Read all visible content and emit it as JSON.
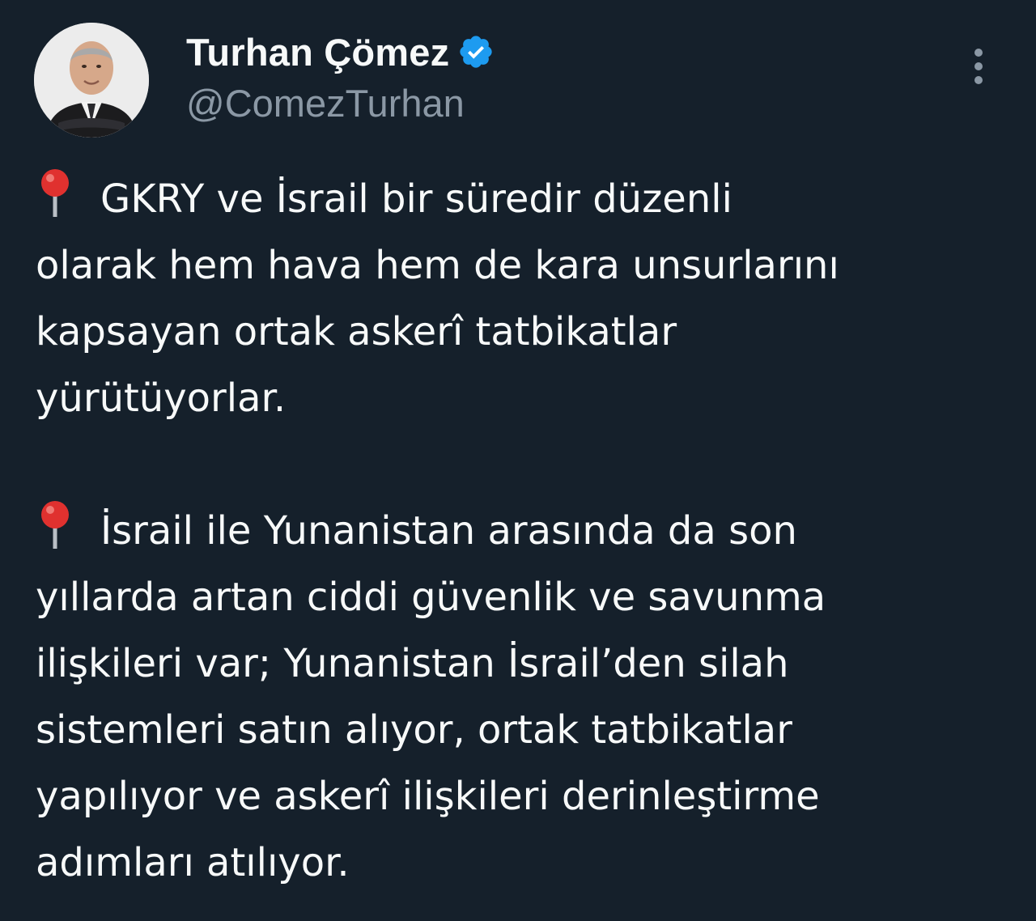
{
  "author": {
    "display_name": "Turhan Çömez",
    "handle": "@ComezTurhan",
    "verified": true,
    "verified_badge_color": "#1d9bf0"
  },
  "icons": {
    "more": "more-vertical-icon",
    "pin": "round-pushpin-icon",
    "verified": "verified-badge-icon"
  },
  "tweet": {
    "paragraphs": [
      {
        "lines": [
          "GKRY ve İsrail bir süredir düzenli",
          "olarak hem hava hem de kara unsurlarını",
          "kapsayan ortak askerî tatbikatlar",
          "yürütüyorlar."
        ]
      },
      {
        "lines": [
          "İsrail ile Yunanistan arasında da son",
          "yıllarda artan ciddi güvenlik ve savunma",
          "ilişkileri var; Yunanistan İsrail’den silah",
          "sistemleri satın alıyor, ortak tatbikatlar",
          "yapılıyor ve askerî ilişkileri derinleştirme",
          "adımları atılıyor."
        ]
      }
    ]
  },
  "colors": {
    "background": "#15202b",
    "text_primary": "#f7f9f9",
    "text_secondary": "#8b98a5",
    "pin": "#e0312f"
  }
}
